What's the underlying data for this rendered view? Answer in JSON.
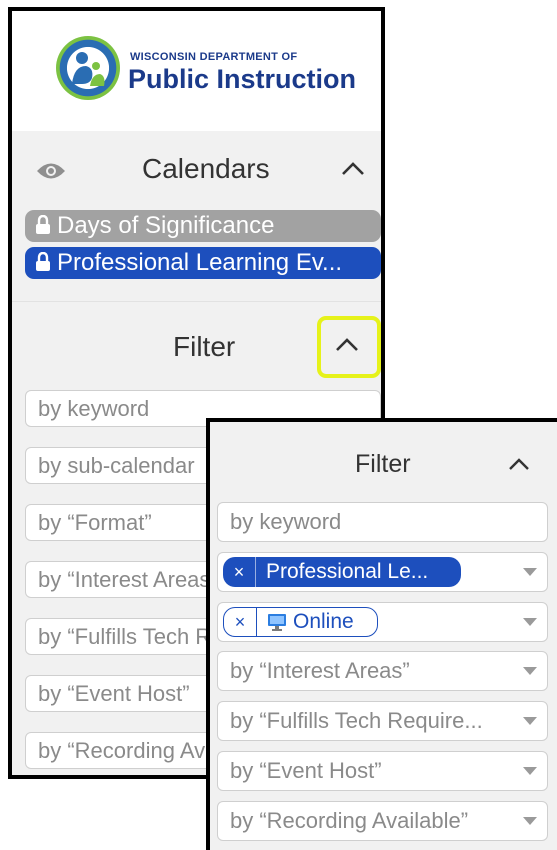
{
  "logo": {
    "top_text": "WISCONSIN DEPARTMENT OF",
    "main_text": "Public Instruction"
  },
  "calendars": {
    "title": "Calendars",
    "items": [
      {
        "label": "Days of Significance",
        "color": "#a2a2a2"
      },
      {
        "label": "Professional Learning Ev...",
        "color": "#1d4fbd"
      }
    ]
  },
  "filter_back": {
    "title": "Filter",
    "fields": [
      {
        "placeholder": "by keyword"
      },
      {
        "placeholder": "by sub-calendar"
      },
      {
        "placeholder": "by “Format”"
      },
      {
        "placeholder": "by “Interest Areas”"
      },
      {
        "placeholder": "by “Fulfills Tech Requirement”"
      },
      {
        "placeholder": "by “Event Host”"
      },
      {
        "placeholder": "by “Recording Available”"
      }
    ]
  },
  "filter_front": {
    "title": "Filter",
    "keyword_placeholder": "by keyword",
    "subcalendar_tag": {
      "remove": "×",
      "label": "Professional Le..."
    },
    "format_tag": {
      "remove": "×",
      "label": "Online"
    },
    "interest_areas": "by “Interest Areas”",
    "tech_requirement": "by “Fulfills Tech Require...",
    "event_host": "by “Event Host”",
    "recording_available": "by “Recording Available”"
  },
  "colors": {
    "accent_blue": "#1d4fbd",
    "highlight": "#e6f21a",
    "panel_bg": "#f1f1f1"
  },
  "icons": [
    "eye-icon",
    "chevron-up-icon",
    "lock-icon",
    "monitor-icon",
    "caret-down-icon",
    "remove-x-icon"
  ]
}
